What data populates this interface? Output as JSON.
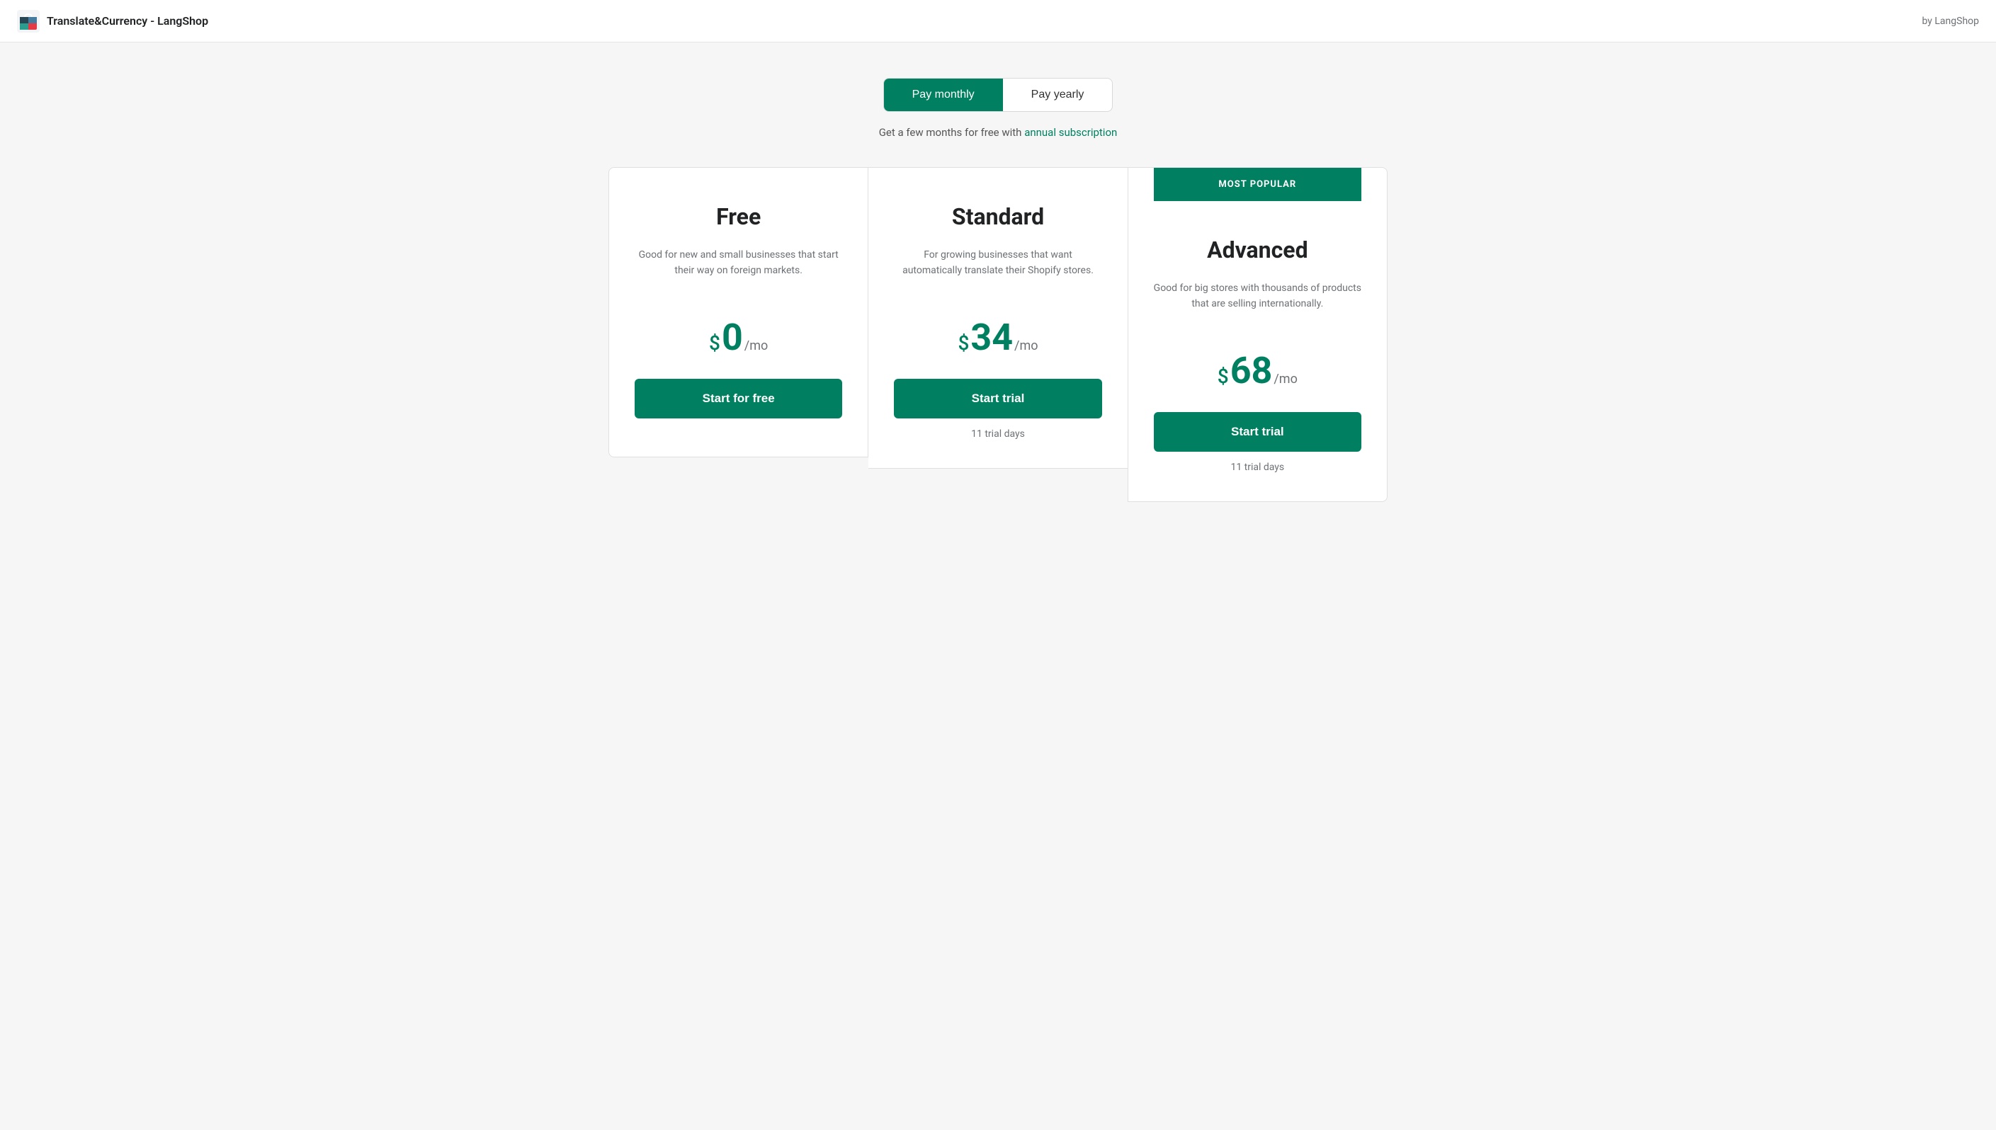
{
  "topBar": {
    "title": "Translate&Currency - LangShop",
    "byLabel": "by LangShop"
  },
  "billing": {
    "monthlyLabel": "Pay monthly",
    "yearlyLabel": "Pay yearly",
    "subtitle": "Get a few months for free with",
    "subtitleLink": "annual subscription",
    "activeToggle": "monthly"
  },
  "plans": [
    {
      "id": "free",
      "name": "Free",
      "description": "Good for new and small businesses that start their way on foreign markets.",
      "priceDollar": "$",
      "priceAmount": "0",
      "pricePeriod": "/mo",
      "ctaLabel": "Start for free",
      "trialText": "",
      "mostPopular": false
    },
    {
      "id": "standard",
      "name": "Standard",
      "description": "For growing businesses that want automatically translate their Shopify stores.",
      "priceDollar": "$",
      "priceAmount": "34",
      "pricePeriod": "/mo",
      "ctaLabel": "Start trial",
      "trialText": "11 trial days",
      "mostPopular": false
    },
    {
      "id": "advanced",
      "name": "Advanced",
      "description": "Good for big stores with thousands of products that are selling internationally.",
      "priceDollar": "$",
      "priceAmount": "68",
      "pricePeriod": "/mo",
      "ctaLabel": "Start trial",
      "trialText": "11 trial days",
      "mostPopular": true,
      "mostPopularLabel": "MOST POPULAR"
    }
  ],
  "colors": {
    "accent": "#008060",
    "white": "#ffffff",
    "textDark": "#202223",
    "textMuted": "#6d7175"
  }
}
